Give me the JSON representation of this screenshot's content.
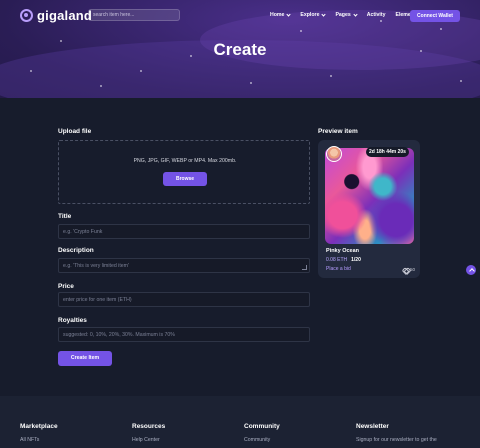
{
  "header": {
    "logo_text": "gigaland",
    "search_placeholder": "search item here...",
    "menu": [
      "Home",
      "Explore",
      "Pages",
      "Activity",
      "Elements"
    ],
    "connect_label": "Connect Wallet"
  },
  "hero": {
    "title": "Create"
  },
  "form": {
    "upload_label": "Upload file",
    "upload_hint": "PNG, JPG, GIF, WEBP or MP4. Max 200mb.",
    "browse_label": "Browse",
    "title_label": "Title",
    "title_placeholder": "e.g. 'Crypto Funk",
    "description_label": "Description",
    "description_placeholder": "e.g. 'This is very limited item'",
    "price_label": "Price",
    "price_placeholder": "enter price for one item (ETH)",
    "royalties_label": "Royalties",
    "royalties_placeholder": "suggested: 0, 10%, 20%, 30%. Maximum is 70%",
    "create_label": "Create Item"
  },
  "preview": {
    "label": "Preview item",
    "timer": "2d  18h  44m  20s",
    "name": "Pinky Ocean",
    "price": "0.08 ETH",
    "qty": "1/20",
    "bid_label": "Place a bid",
    "likes": "50"
  },
  "footer": {
    "columns": [
      {
        "title": "Marketplace",
        "link": "All NFTs"
      },
      {
        "title": "Resources",
        "link": "Help Center"
      },
      {
        "title": "Community",
        "link": "Community"
      },
      {
        "title": "Newsletter",
        "link": "Signup for our newsletter to get the"
      }
    ]
  },
  "colors": {
    "accent": "#7453e6",
    "background": "#171c2c",
    "hero": "#3a2670"
  }
}
